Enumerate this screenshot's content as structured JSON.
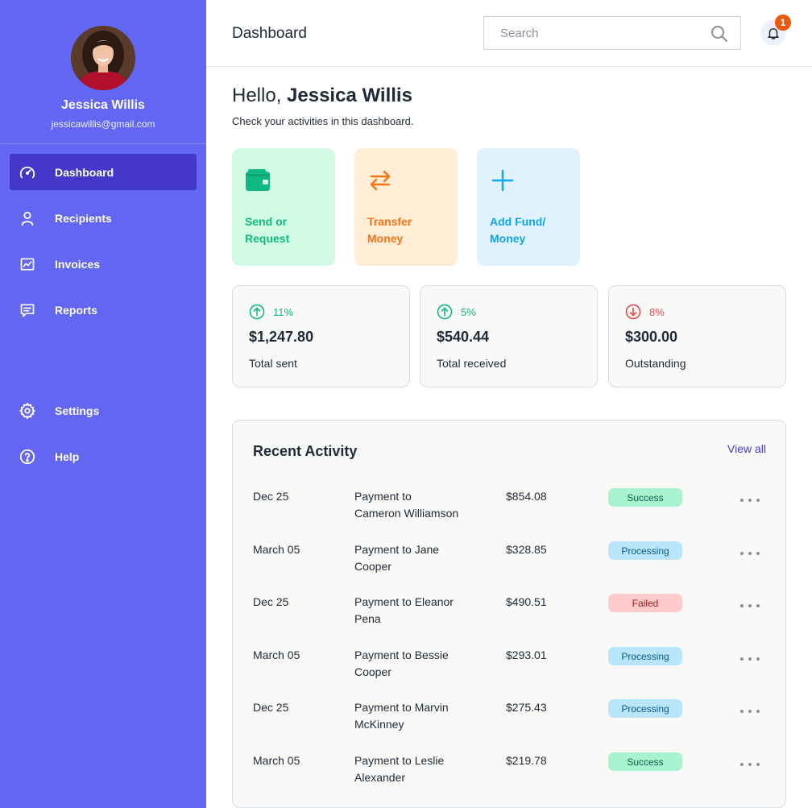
{
  "sidebar": {
    "user": {
      "name": "Jessica Willis",
      "email": "jessicawillis@gmail.com"
    },
    "items": [
      {
        "label": "Dashboard",
        "icon": "speedometer-icon",
        "active": true
      },
      {
        "label": "Recipients",
        "icon": "user-icon"
      },
      {
        "label": "Invoices",
        "icon": "chart-icon"
      },
      {
        "label": "Reports",
        "icon": "message-icon"
      },
      {
        "label": "Settings",
        "icon": "gear-icon"
      },
      {
        "label": "Help",
        "icon": "help-icon"
      }
    ]
  },
  "header": {
    "title": "Dashboard",
    "search_placeholder": "Search",
    "notification_count": "1"
  },
  "greeting": {
    "prefix": "Hello, ",
    "name": "Jessica Willis",
    "subtitle": "Check your activities in this dashboard."
  },
  "actions": [
    {
      "label": "Send or Request",
      "icon": "wallet-icon",
      "bg": "#d1fae5",
      "color": "#10b981"
    },
    {
      "label": "Transfer Money",
      "icon": "transfer-icon",
      "bg": "#ffedd5",
      "color": "#f97316"
    },
    {
      "label": "Add Fund/ Money",
      "icon": "plus-icon",
      "bg": "#e0f2fe",
      "color": "#0ea5e9"
    }
  ],
  "stats": [
    {
      "pct": "11%",
      "direction": "up",
      "value": "$1,247.80",
      "label": "Total sent",
      "color": "#10b981"
    },
    {
      "pct": "5%",
      "direction": "up",
      "value": "$540.44",
      "label": "Total received",
      "color": "#10b981"
    },
    {
      "pct": "8%",
      "direction": "down",
      "value": "$300.00",
      "label": "Outstanding",
      "color": "#ef4444"
    }
  ],
  "activity": {
    "title": "Recent Activity",
    "view_all": "View all",
    "rows": [
      {
        "date": "Dec 25",
        "desc": "Payment to Cameron Williamson",
        "amount": "$854.08",
        "status": "Success"
      },
      {
        "date": "March 05",
        "desc": "Payment to Jane Cooper",
        "amount": "$328.85",
        "status": "Processing"
      },
      {
        "date": "Dec 25",
        "desc": "Payment to Eleanor Pena",
        "amount": "$490.51",
        "status": "Failed"
      },
      {
        "date": "March 05",
        "desc": "Payment to Bessie Cooper",
        "amount": "$293.01",
        "status": "Processing"
      },
      {
        "date": "Dec 25",
        "desc": "Payment to Marvin McKinney",
        "amount": "$275.43",
        "status": "Processing"
      },
      {
        "date": "March 05",
        "desc": "Payment to Leslie Alexander",
        "amount": "$219.78",
        "status": "Success"
      }
    ]
  }
}
